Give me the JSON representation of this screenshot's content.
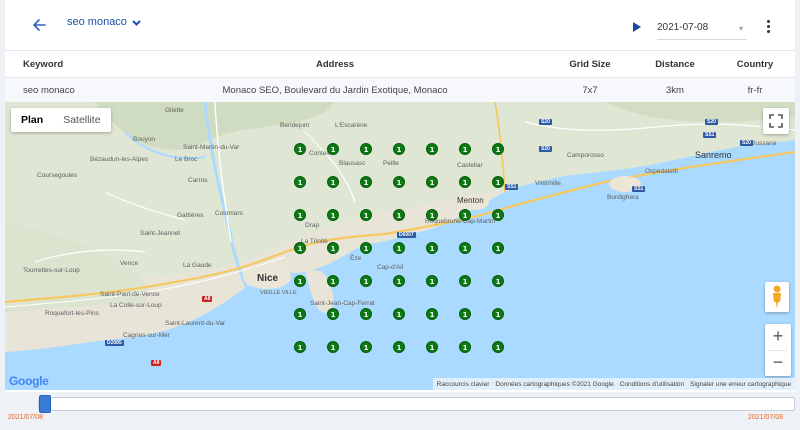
{
  "header": {
    "keyword_select": "seo monaco",
    "date": "2021-07-08"
  },
  "table": {
    "columns": [
      "Keyword",
      "Address",
      "Grid Size",
      "Distance",
      "Country"
    ],
    "row": {
      "keyword": "seo monaco",
      "address": "Monaco SEO, Boulevard du Jardin Exotique, Monaco",
      "grid_size": "7x7",
      "distance": "3km",
      "country": "fr-fr"
    }
  },
  "map": {
    "type_options": [
      "Plan",
      "Satellite"
    ],
    "selected_type": "Plan",
    "google_logo": "Google",
    "attribution": [
      "Raccourcis clavier",
      "Données cartographiques ©2021 Google",
      "Conditions d'utilisation",
      "Signaler une erreur cartographique"
    ],
    "zoom_in": "+",
    "zoom_out": "−",
    "grid_rank_value": "1",
    "grid_rows": 7,
    "grid_cols": 7,
    "place_labels": [
      "Bendejum",
      "L'Escarène",
      "Gilette",
      "Bouyon",
      "Saint-Martin-du-Var",
      "Bézaudun-les-Alpes",
      "Le Broc",
      "Coursegoules",
      "Carros",
      "Gattières",
      "Colomars",
      "Saint-Jeannet",
      "Vence",
      "La Gaude",
      "Tourrettes-sur-Loup",
      "Saint-Paul-de-Vence",
      "La Colle-sur-Loup",
      "Roquefort-les-Pins",
      "Saint-Laurent-du-Var",
      "Cagnes-sur-Mer",
      "Nice",
      "VIEILLE VILLE",
      "Saint-Jean-Cap-Ferrat",
      "Drap",
      "La Trinité",
      "Èze",
      "Cap-d'Ail",
      "Blausasc",
      "Peille",
      "Castellar",
      "Menton",
      "Roquebrune-Cap-Martin",
      "Vintimille",
      "Camporosso",
      "Bordighera",
      "Ospedaletti",
      "Sanremo",
      "Bussana",
      "Contes"
    ],
    "road_shields": [
      "S20",
      "S20",
      "SS1",
      "SS1",
      "D6007",
      "A8",
      "A8",
      "D2085",
      "S20",
      "SS1",
      "S20"
    ]
  },
  "timeline": {
    "start_label": "2021/07/08",
    "end_label": "2021/07/08",
    "position": 0.0
  }
}
